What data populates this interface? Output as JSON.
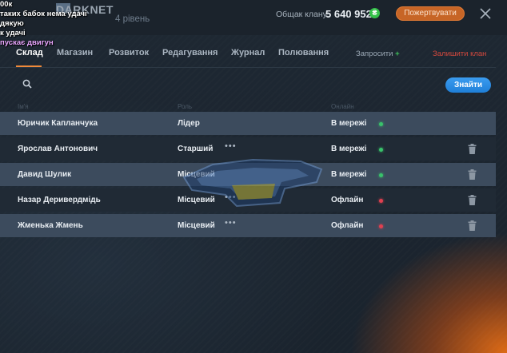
{
  "overlay": {
    "line1": "00к",
    "line2": "таких бабок нема удачі дякую",
    "line3": "к удачі",
    "line4": "пускає двигун"
  },
  "header": {
    "clan_name": "DARKNET",
    "clan_level": "4 рівень",
    "bank_label": "Общак клану:",
    "bank_value": "5 640 952",
    "coin_symbol": "₴",
    "donate_label": "Пожертвувати"
  },
  "tabs": [
    {
      "label": "Склад",
      "active": true
    },
    {
      "label": "Магазин",
      "active": false
    },
    {
      "label": "Розвиток",
      "active": false
    },
    {
      "label": "Редагування",
      "active": false
    },
    {
      "label": "Журнал",
      "active": false
    },
    {
      "label": "Полювання",
      "active": false
    }
  ],
  "actions": {
    "invite_label": "Запросити",
    "invite_plus": "+",
    "leave_label": "Залишити клан"
  },
  "search": {
    "placeholder": "",
    "value": "",
    "button_label": "Знайти"
  },
  "columns": {
    "name": "Ім'я",
    "role": "Роль",
    "online": "Онлайн"
  },
  "members": [
    {
      "name": "Юричик Капланчука",
      "role": "Лідер",
      "status": "В мережі",
      "online": true,
      "menu": false,
      "trash": false
    },
    {
      "name": "Ярослав Антонович",
      "role": "Старший",
      "status": "В мережі",
      "online": true,
      "menu": true,
      "trash": true
    },
    {
      "name": "Давид Шулик",
      "role": "Місцевий",
      "status": "В мережі",
      "online": true,
      "menu": false,
      "trash": true
    },
    {
      "name": "Назар Деривердмідь",
      "role": "Місцевий",
      "status": "Офлайн",
      "online": false,
      "menu": true,
      "trash": true
    },
    {
      "name": "Жменька Жмень",
      "role": "Місцевий",
      "status": "Офлайн",
      "online": false,
      "menu": true,
      "trash": true
    }
  ],
  "menu_glyph": "•••",
  "colors": {
    "accent_orange": "#c76526",
    "primary_blue": "#2b8de6",
    "online_green": "#39c26b",
    "offline_red": "#e04050",
    "leave_red": "#d2483d"
  }
}
